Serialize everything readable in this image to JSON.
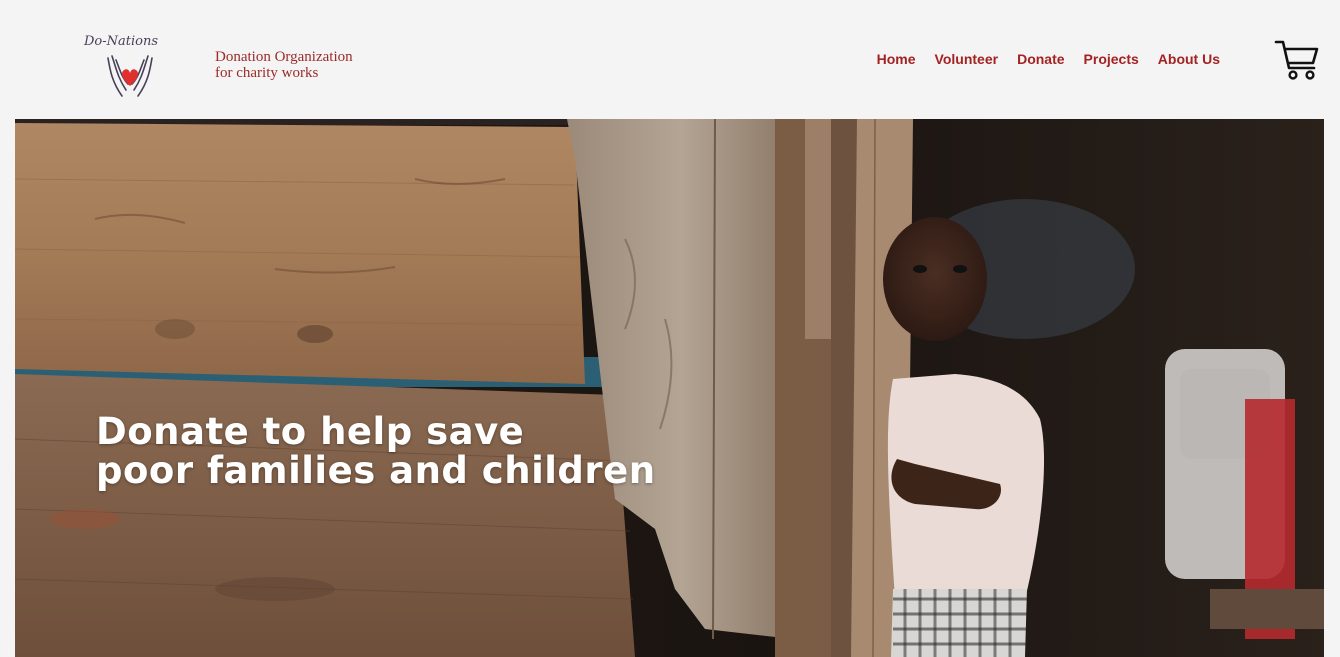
{
  "brand": {
    "logo_text": "Do-Nations",
    "tagline_line1": "Donation Organization",
    "tagline_line2": "for charity works"
  },
  "nav": {
    "items": [
      {
        "label": "Home"
      },
      {
        "label": "Volunteer"
      },
      {
        "label": "Donate"
      },
      {
        "label": "Projects"
      },
      {
        "label": "About Us"
      }
    ]
  },
  "icons": {
    "logo": "hands-heart-icon",
    "cart": "shopping-cart-icon"
  },
  "colors": {
    "nav_text": "#a32222",
    "tagline": "#9c2a2a",
    "background": "#f4f4f4",
    "heart": "#e0302e"
  },
  "hero": {
    "title_line1": "Donate to help save",
    "title_line2": "poor families and children"
  }
}
